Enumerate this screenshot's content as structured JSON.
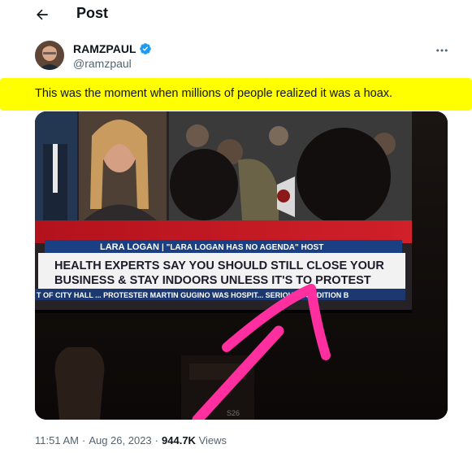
{
  "topbar": {
    "title": "Post",
    "back_icon": "arrow-left-icon"
  },
  "author": {
    "display_name": "RAMZPAUL",
    "handle": "@ramzpaul",
    "verified_icon": "verified-badge-icon",
    "verified_color": "#1d9bf0"
  },
  "post": {
    "text": "This was the moment when millions of people realized it was a hoax.",
    "highlight_color": "#ffff00"
  },
  "media": {
    "chyron_name": "LARA LOGAN",
    "chyron_show": "| \"LARA LOGAN HAS NO AGENDA\" HOST",
    "headline_line1": "HEALTH EXPERTS SAY YOU SHOULD STILL CLOSE YOUR",
    "headline_line2": "BUSINESS & STAY INDOORS UNLESS IT'S TO PROTEST",
    "ticker": "T OF CITY HALL ... PROTESTER MARTIN GUGINO WAS HOSPIT... SERIOUS CONDITION B",
    "tv_label": "S26",
    "arrow_color": "#ff2fa0"
  },
  "meta": {
    "time": "11:51 AM",
    "separator": "·",
    "date": "Aug 26, 2023",
    "views_count": "944.7K",
    "views_label": "Views"
  },
  "colors": {
    "text": "#0f1419",
    "muted": "#536471",
    "accent": "#1d9bf0"
  }
}
